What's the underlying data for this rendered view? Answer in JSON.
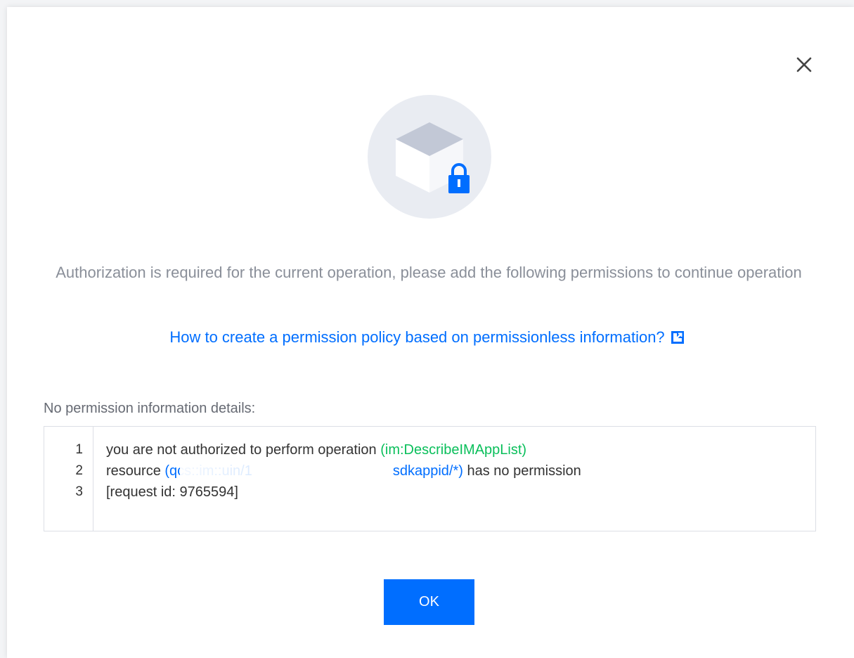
{
  "dialog": {
    "message": "Authorization is required for the current operation, please add the following permissions to continue operation",
    "help_link": "How to create a permission policy based on permissionless information?",
    "details_label": "No permission information details:",
    "ok_label": "OK"
  },
  "details": {
    "lines": [
      {
        "num": "1",
        "prefix": "you are not authorized to perform operation ",
        "highlight": "(im:DescribeIMAppList)",
        "suffix": ""
      },
      {
        "num": "2",
        "prefix": "resource ",
        "highlight": "(qcs::im::uin/1          sdkappid/*)",
        "suffix": " has no permission"
      },
      {
        "num": "3",
        "prefix": "[request id: 9765594]",
        "highlight": "",
        "suffix": ""
      }
    ]
  },
  "icons": {
    "close": "close-icon",
    "illustration": "locked-box-icon",
    "external_link": "external-link-icon"
  },
  "colors": {
    "primary": "#006eff",
    "success": "#0abf5b",
    "muted_text": "#8a8f99",
    "border": "#dcdfe5"
  }
}
